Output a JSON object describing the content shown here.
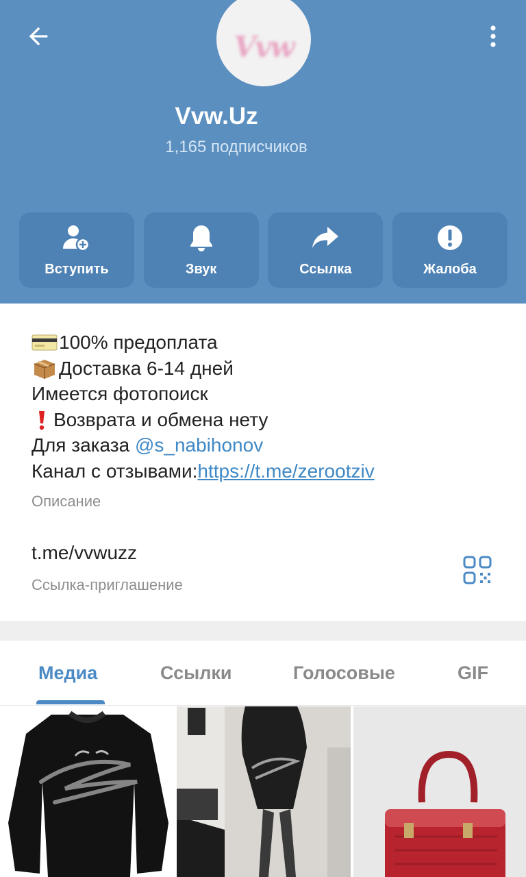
{
  "header": {
    "channel_name": "Vvw.Uz",
    "subscribers": "1,165 подписчиков",
    "avatar_text": "Vvw",
    "back_icon": "arrow-left-icon",
    "more_icon": "more-vertical-icon",
    "bg_color": "#5a8fc0"
  },
  "actions": [
    {
      "label": "Вступить",
      "icon": "add-user-icon"
    },
    {
      "label": "Звук",
      "icon": "bell-icon"
    },
    {
      "label": "Ссылка",
      "icon": "share-icon"
    },
    {
      "label": "Жалоба",
      "icon": "alert-icon"
    }
  ],
  "description": {
    "line1_emoji": "credit-card-emoji",
    "line1": "100% предоплата",
    "line2_emoji": "package-emoji",
    "line2": "Доставка 6-14 дней",
    "line3": "Имеется фотопоиск",
    "line4_emoji": "exclamation-emoji",
    "line4": " Возврата и обмена нету",
    "line5_prefix": "Для заказа ",
    "line5_mention": "@s_nabihonov",
    "line6_prefix": "Канал с отзывами:",
    "line6_url": "https://t.me/zerootziv",
    "label": "Описание"
  },
  "invite": {
    "link": "t.me/vvwuzz",
    "label": "Ссылка-приглашение",
    "qr_icon": "qr-code-icon"
  },
  "tabs": [
    {
      "label": "Медиа",
      "active": true
    },
    {
      "label": "Ссылки",
      "active": false
    },
    {
      "label": "Голосовые",
      "active": false
    },
    {
      "label": "GIF",
      "active": false
    }
  ],
  "colors": {
    "accent": "#4b8ac4",
    "link": "#3e88c5",
    "action_bg": "#4e82b4"
  }
}
